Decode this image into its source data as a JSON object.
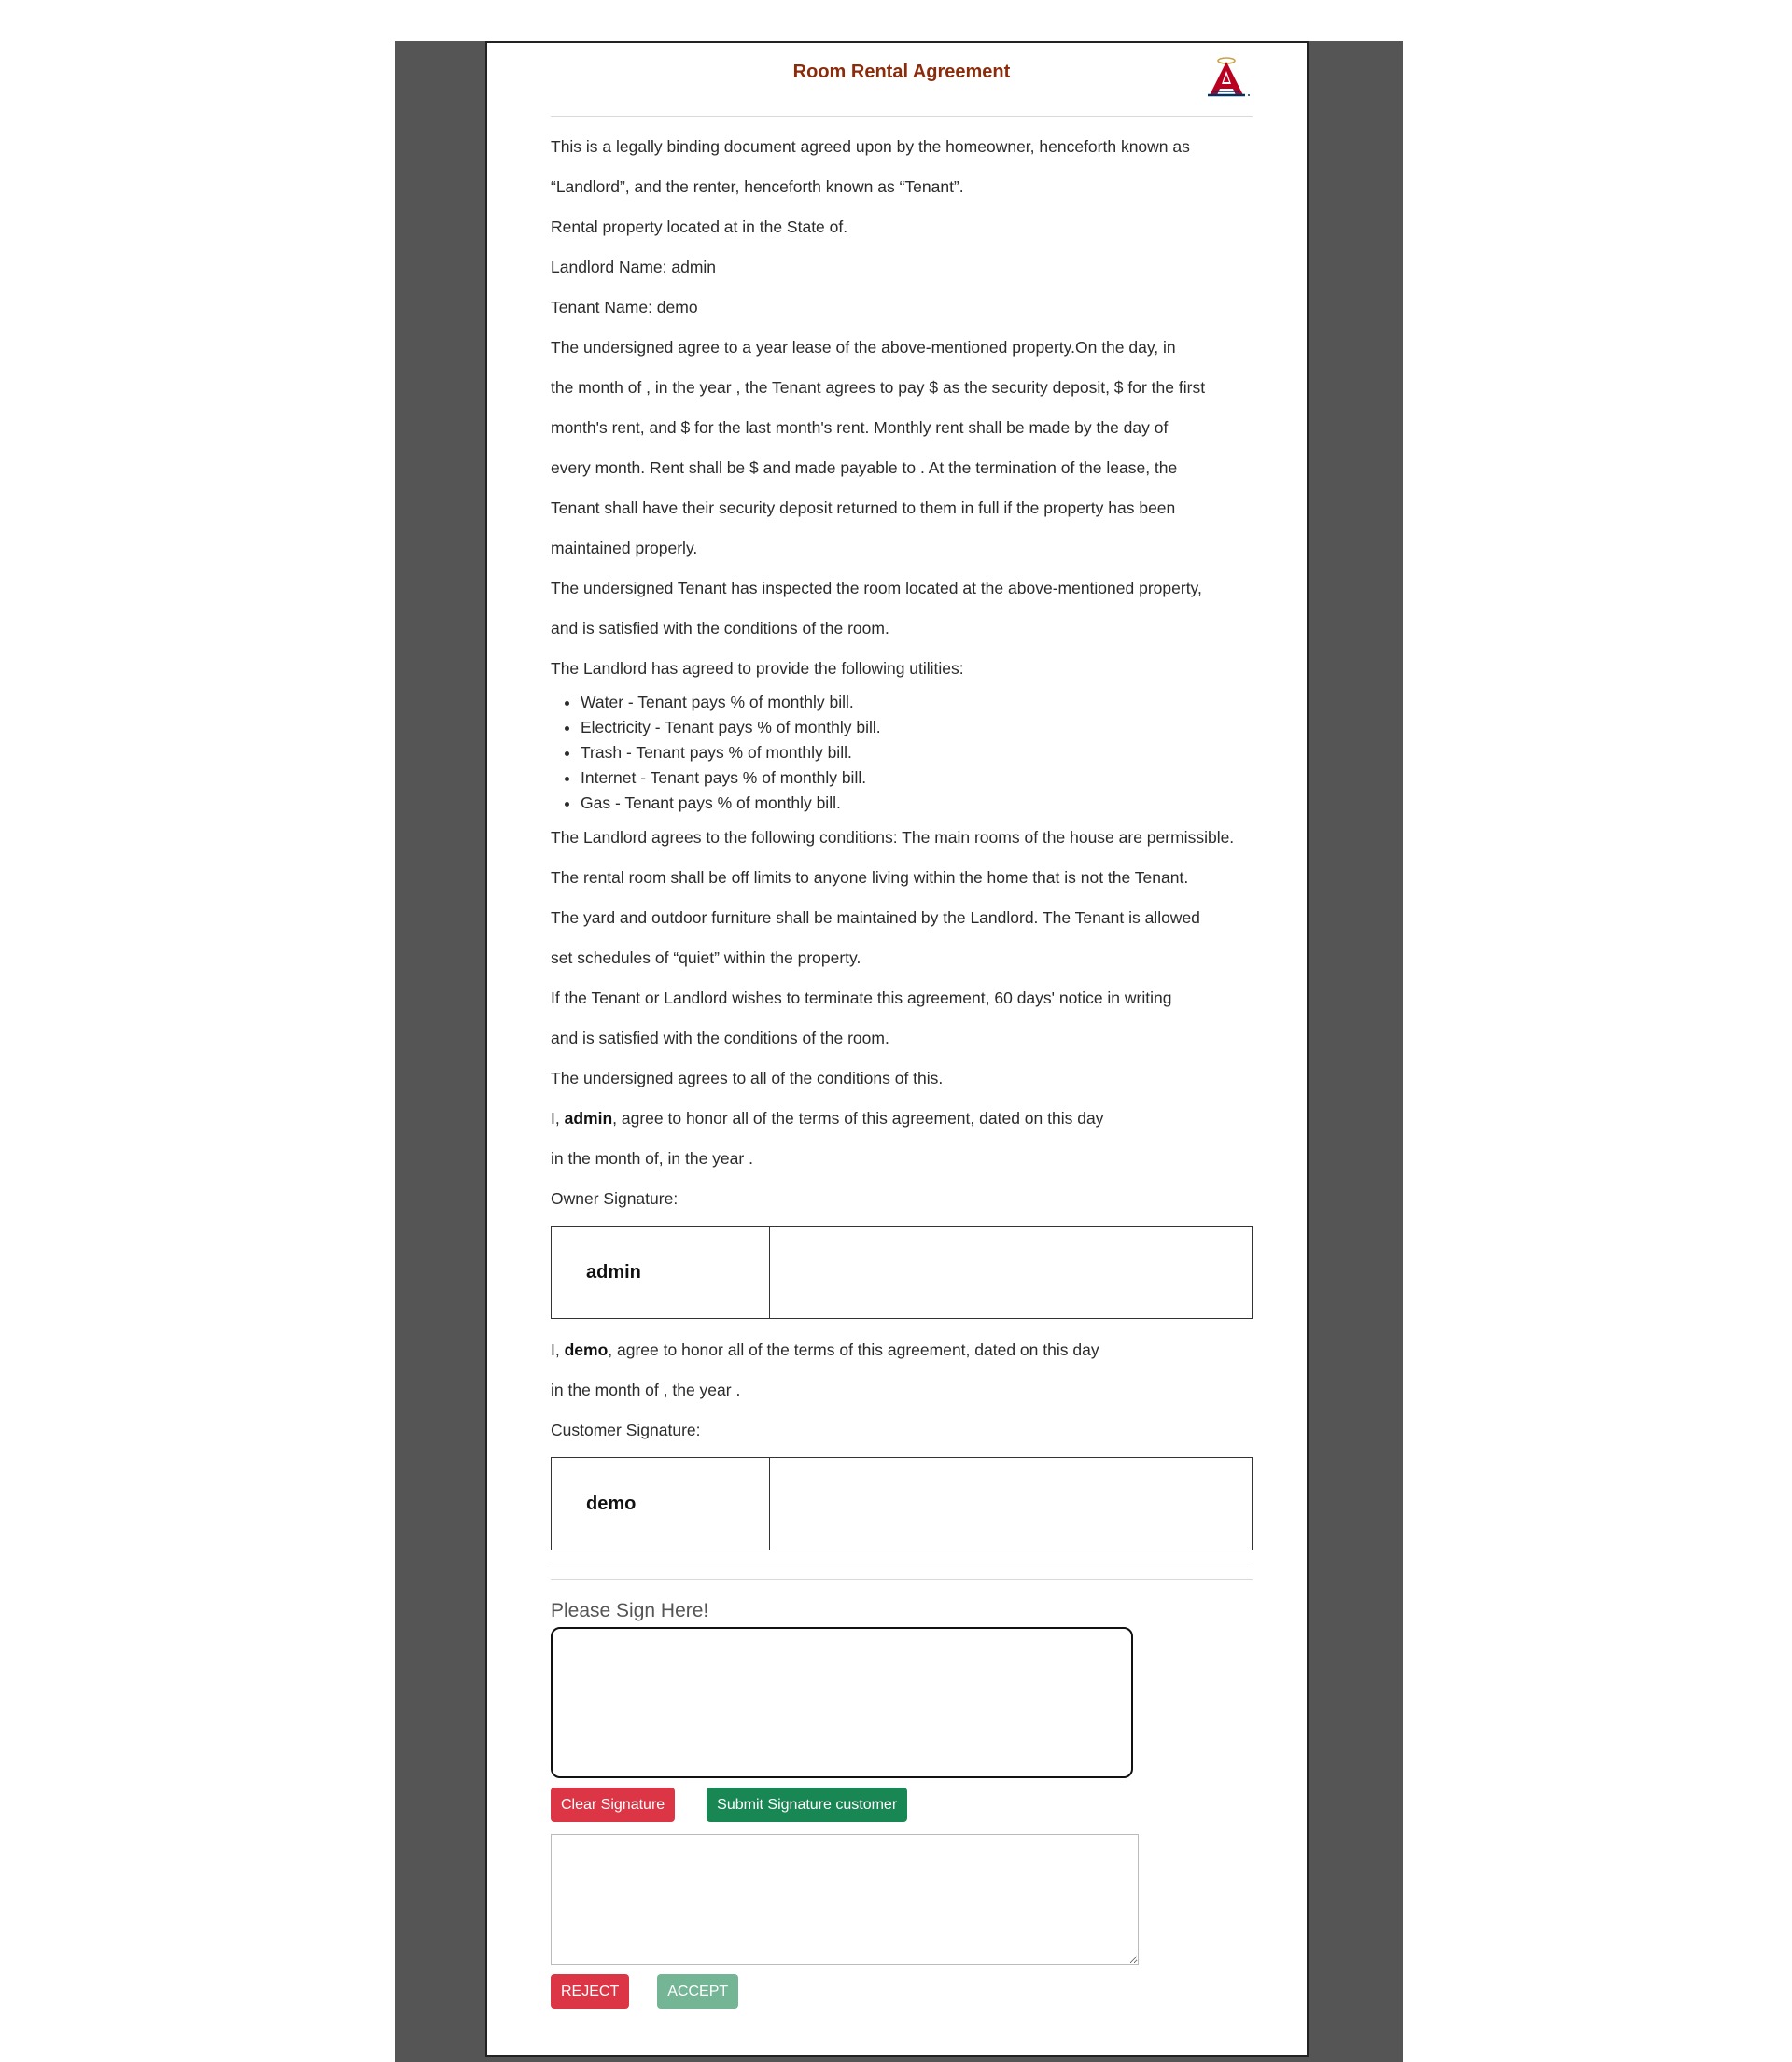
{
  "document": {
    "title": "Room Rental Agreement",
    "logo_icon": "angels-logo-icon"
  },
  "body": {
    "intro_1": "This is a legally binding document agreed upon by the homeowner, henceforth known as",
    "intro_2": "“Landlord”, and the renter, henceforth known as “Tenant”.",
    "property_line": "Rental property located at in the State of.",
    "landlord_line": "Landlord Name: admin",
    "tenant_line": "Tenant Name: demo",
    "lease_1": "The undersigned agree to a year lease of the above-mentioned property.On the day, in",
    "lease_2": "the month of , in the year , the Tenant agrees to pay $ as the security deposit, $ for the first",
    "lease_3": "month's rent, and $ for the last month's rent. Monthly rent shall be made by the day of",
    "lease_4": "every month. Rent shall be $ and made payable to . At the termination of the lease, the",
    "lease_5": "Tenant shall have their security deposit returned to them in full if the property has been",
    "lease_6": "maintained properly.",
    "inspect_1": "The undersigned Tenant has inspected the room located at the above-mentioned property,",
    "inspect_2": "and is satisfied with the conditions of the room.",
    "utilities_intro": "The Landlord has agreed to provide the following utilities:",
    "utilities": [
      "Water - Tenant pays % of monthly bill.",
      "Electricity - Tenant pays % of monthly bill.",
      "Trash - Tenant pays % of monthly bill.",
      "Internet - Tenant pays % of monthly bill.",
      "Gas - Tenant pays % of monthly bill."
    ],
    "conditions_1": "The Landlord agrees to the following conditions: The main rooms of the house are permissible.",
    "conditions_2": "The rental room shall be off limits to anyone living within the home that is not the Tenant.",
    "conditions_3": "The yard and outdoor furniture shall be maintained by the Landlord. The Tenant is allowed",
    "conditions_4": "set schedules of “quiet” within the property.",
    "terminate_1": "If the Tenant or Landlord wishes to terminate this agreement, 60 days' notice in writing",
    "terminate_2": "and is satisfied with the conditions of the room.",
    "agree_all": "The undersigned agrees to all of the conditions of this."
  },
  "owner": {
    "honor_prefix": "I, ",
    "name": "admin",
    "honor_suffix": ", agree to honor all of the terms of this agreement, dated on this day",
    "date_line": "in the month of, in the year .",
    "signature_label": "Owner Signature:",
    "signature_name": "admin"
  },
  "customer": {
    "honor_prefix": "I, ",
    "name": "demo",
    "honor_suffix": ", agree to honor all of the terms of this agreement, dated on this day",
    "date_line": "in the month of , the year .",
    "signature_label": "Customer Signature:",
    "signature_name": "demo"
  },
  "sign": {
    "label": "Please Sign Here!",
    "clear_button": "Clear Signature",
    "submit_button": "Submit Signature customer",
    "comment_value": "",
    "reject_button": "REJECT",
    "accept_button": "ACCEPT"
  },
  "colors": {
    "title": "#8b2b0b",
    "danger": "#dc3545",
    "success": "#198754",
    "frame": "#555555"
  }
}
